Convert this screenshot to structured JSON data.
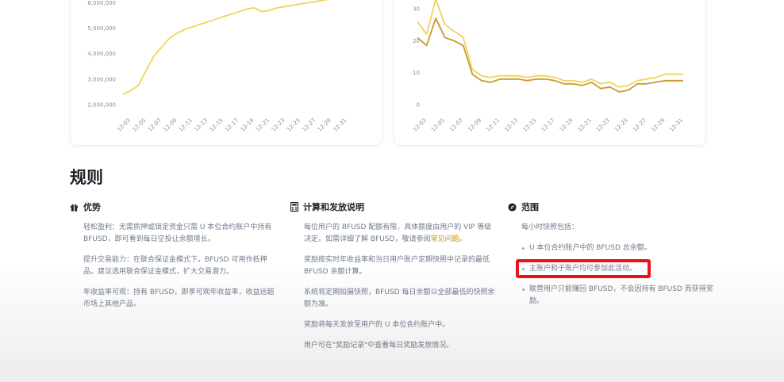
{
  "charts": {
    "left": {
      "y_ticks": [
        "6,000,000",
        "5,000,000",
        "4,000,000",
        "3,000,000",
        "2,000,000"
      ],
      "x_ticks": [
        "12-03",
        "12-05",
        "12-07",
        "12-09",
        "12-11",
        "12-13",
        "12-15",
        "12-17",
        "12-19",
        "12-21",
        "12-23",
        "12-25",
        "12-27",
        "12-29",
        "12-31"
      ]
    },
    "right": {
      "y_ticks": [
        "30",
        "20",
        "10",
        "0"
      ],
      "x_ticks": [
        "12-03",
        "12-05",
        "12-07",
        "12-09",
        "12-11",
        "12-13",
        "12-15",
        "12-17",
        "12-19",
        "12-21",
        "12-23",
        "12-25",
        "12-27",
        "12-29",
        "12-31"
      ]
    }
  },
  "chart_data": [
    {
      "type": "line",
      "title": "",
      "xlabel": "",
      "ylabel": "",
      "ylim": [
        2000000,
        6200000
      ],
      "color": "#f0d35a",
      "x": [
        "12-02",
        "12-03",
        "12-04",
        "12-05",
        "12-06",
        "12-07",
        "12-08",
        "12-09",
        "12-10",
        "12-11",
        "12-12",
        "12-13",
        "12-14",
        "12-15",
        "12-16",
        "12-17",
        "12-18",
        "12-19",
        "12-20",
        "12-21",
        "12-22",
        "12-23",
        "12-24",
        "12-25",
        "12-26",
        "12-27",
        "12-28",
        "12-29",
        "12-30",
        "12-31"
      ],
      "values": [
        2400000,
        2550000,
        2750000,
        3350000,
        3900000,
        4250000,
        4600000,
        4800000,
        4950000,
        5050000,
        5150000,
        5250000,
        5350000,
        5450000,
        5550000,
        5650000,
        5750000,
        5800000,
        5650000,
        5700000,
        5800000,
        5850000,
        5900000,
        5950000,
        6000000,
        6050000,
        6100000,
        6150000,
        6200000,
        6250000
      ]
    },
    {
      "type": "line",
      "title": "",
      "xlabel": "",
      "ylabel": "",
      "ylim": [
        0,
        32
      ],
      "x": [
        "12-02",
        "12-03",
        "12-04",
        "12-05",
        "12-06",
        "12-07",
        "12-08",
        "12-09",
        "12-10",
        "12-11",
        "12-12",
        "12-13",
        "12-14",
        "12-15",
        "12-16",
        "12-17",
        "12-18",
        "12-19",
        "12-20",
        "12-21",
        "12-22",
        "12-23",
        "12-24",
        "12-25",
        "12-26",
        "12-27",
        "12-28",
        "12-29",
        "12-30",
        "12-31"
      ],
      "series": [
        {
          "color": "#f0d35a",
          "values": [
            26,
            22,
            33,
            25,
            23,
            21,
            11,
            9,
            8.5,
            9,
            9,
            9,
            8.5,
            9,
            9,
            8.5,
            7.5,
            7.5,
            7,
            8,
            6.5,
            7,
            5.5,
            6,
            7.5,
            8,
            8.5,
            9.5,
            9.5,
            9.5
          ]
        },
        {
          "color": "#c99a2e",
          "values": [
            21,
            18.5,
            27,
            21,
            20,
            18.5,
            9.5,
            7.5,
            7,
            8,
            8,
            8,
            7.5,
            8,
            8,
            7.5,
            6.5,
            6.5,
            6,
            7,
            5,
            5.5,
            4,
            4.5,
            6.5,
            6.5,
            7,
            7.5,
            7.5,
            7.5
          ]
        }
      ]
    }
  ],
  "rules": {
    "title": "规则",
    "advantages": {
      "heading": "优势",
      "icon": "gift-icon",
      "items": [
        "轻松盈利：无需质押或锁定资金只需 U 本位合约账户中持有 BFUSD，即可看到每日空投让余额增长。",
        "提升交易能力：在联合保证金模式下，BFUSD 可用作抵押品。建议选用联合保证金模式，扩大交易潜力。",
        "年收益率可观：持有 BFUSD，即享可观年收益率，收益远超市场上其他产品。"
      ]
    },
    "calculation": {
      "heading": "计算和发放说明",
      "icon": "calculator-icon",
      "items": [
        "奖励按实时年收益率和当日用户账户定期快照中记录的最低 BFUSD 余额计算。",
        "系统将定期拍摄快照，BFUSD 每日余额以全部最低的快照余额为准。",
        "奖励将每天发放至用户的 U 本位合约账户中。",
        "用户可在\"奖励记录\"中查看每日奖励发放情况。"
      ],
      "first_item_prefix": "每位用户的 BFUSD 配额有限，具体额度由用户的 VIP 等级决定。如需详细了解 BFUSD，敬请参阅",
      "first_item_link": "常见问题",
      "first_item_suffix": "。"
    },
    "scope": {
      "heading": "范围",
      "icon": "scope-icon",
      "intro": "每小时快照包括：",
      "items": [
        "U 本位合约账户中的 BFUSD 总余额。",
        "主账户和子账户均可参加此活动。",
        "联营用户只能赚回 BFUSD，不会因持有 BFUSD 而获得奖励。"
      ]
    }
  },
  "colors": {
    "accent_link": "#c99400",
    "highlight_box": "#e8141c",
    "line_light": "#f0d35a",
    "line_dark": "#c99a2e"
  }
}
